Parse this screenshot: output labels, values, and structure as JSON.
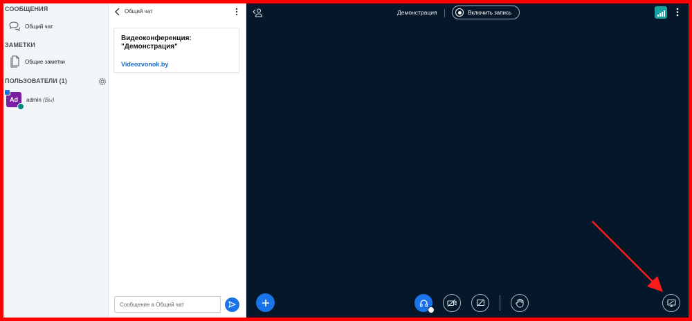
{
  "userlist": {
    "messages_title": "СООБЩЕНИЯ",
    "public_chat_label": "Общий чат",
    "notes_title": "ЗАМЕТКИ",
    "shared_notes_label": "Общие заметки",
    "users_title": "ПОЛЬЗОВАТЕЛИ (1)",
    "users": [
      {
        "initials": "Ad",
        "name": "admin",
        "suffix": "(Вы)"
      }
    ]
  },
  "chat": {
    "title": "Общий чат",
    "welcome_title": "Видеоконференция: \"Демонстрация\"",
    "welcome_link": "Videozvonok.by",
    "input_placeholder": "Сообщение в Общий чат"
  },
  "stage": {
    "meeting_title": "Демонстрация",
    "record_label": "Включить запись"
  },
  "colors": {
    "frame": "#ff0000",
    "stage_bg": "#06172a",
    "accent": "#1a73e8",
    "avatar": "#7b1fa2",
    "connection": "#17a2a2"
  },
  "icons": {
    "chat": "chat-bubbles-icon",
    "notes": "notes-icon",
    "gear": "gear-icon",
    "back": "chevron-left-icon",
    "more": "more-vertical-icon",
    "send": "send-icon",
    "users_toggle": "user-list-icon",
    "record": "record-icon",
    "connection": "signal-bars-icon",
    "add": "plus-icon",
    "audio": "headset-icon",
    "video": "video-off-icon",
    "screen": "screenshare-off-icon",
    "raise_hand": "hand-icon",
    "presentation": "presentation-icon"
  }
}
